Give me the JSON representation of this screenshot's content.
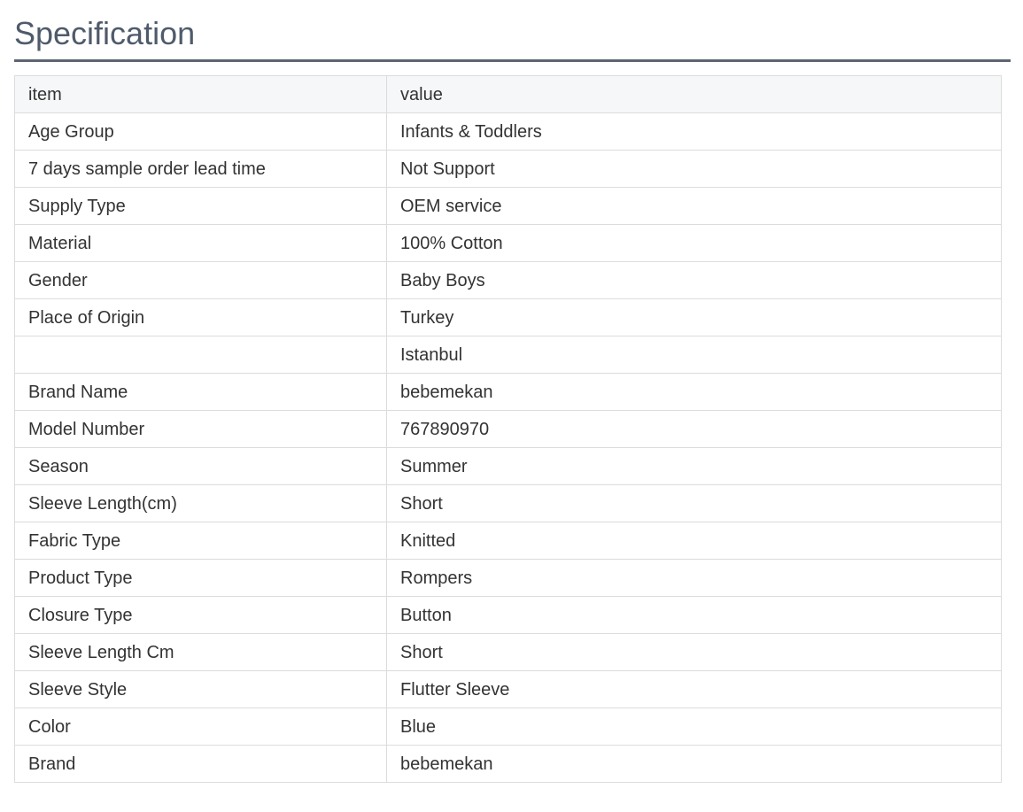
{
  "section": {
    "title": "Specification"
  },
  "table": {
    "headers": {
      "item": "item",
      "value": "value"
    },
    "rows": [
      {
        "item": "Age Group",
        "value": "Infants & Toddlers"
      },
      {
        "item": "7 days sample order lead time",
        "value": "Not Support"
      },
      {
        "item": "Supply Type",
        "value": "OEM service"
      },
      {
        "item": "Material",
        "value": "100% Cotton"
      },
      {
        "item": "Gender",
        "value": "Baby Boys"
      },
      {
        "item": "Place of Origin",
        "value": "Turkey"
      },
      {
        "item": "",
        "value": "Istanbul"
      },
      {
        "item": "Brand Name",
        "value": "bebemekan"
      },
      {
        "item": "Model Number",
        "value": "767890970"
      },
      {
        "item": "Season",
        "value": "Summer"
      },
      {
        "item": "Sleeve Length(cm)",
        "value": "Short"
      },
      {
        "item": "Fabric Type",
        "value": "Knitted"
      },
      {
        "item": "Product Type",
        "value": "Rompers"
      },
      {
        "item": "Closure Type",
        "value": "Button"
      },
      {
        "item": "Sleeve Length Cm",
        "value": "Short"
      },
      {
        "item": "Sleeve Style",
        "value": "Flutter Sleeve"
      },
      {
        "item": "Color",
        "value": "Blue"
      },
      {
        "item": "Brand",
        "value": "bebemekan"
      }
    ]
  }
}
